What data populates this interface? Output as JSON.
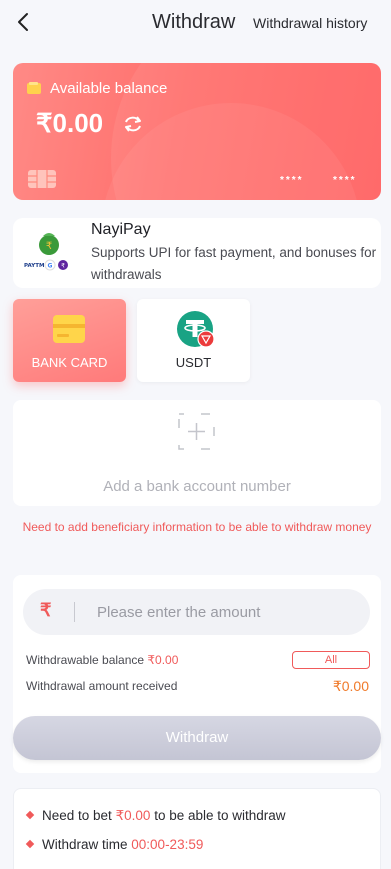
{
  "header": {
    "title": "Withdraw",
    "history_label": "Withdrawal history"
  },
  "balance_card": {
    "label": "Available balance",
    "amount": "₹0.00",
    "mask1": "****",
    "mask2": "****"
  },
  "nayipay": {
    "title": "NayiPay",
    "description": "Supports UPI for fast payment, and bonuses for withdrawals",
    "logo_text": "PAYTM"
  },
  "methods": [
    {
      "label": "BANK CARD",
      "icon": "bank-card-icon",
      "selected": true
    },
    {
      "label": "USDT",
      "icon": "tether-icon",
      "selected": false
    }
  ],
  "add_bank": {
    "label": "Add a bank account number"
  },
  "warning": "Need to add beneficiary information to be able to withdraw money",
  "amount_panel": {
    "currency_symbol": "₹",
    "placeholder": "Please enter the amount",
    "withdrawable_label": "Withdrawable balance ",
    "withdrawable_value": "₹0.00",
    "all_label": "All",
    "received_label": "Withdrawal amount received",
    "received_value": "₹0.00",
    "withdraw_label": "Withdraw"
  },
  "rules": {
    "r1_pre": "Need to bet ",
    "r1_value": "₹0.00",
    "r1_post": " to be able to withdraw",
    "r2_pre": "Withdraw time ",
    "r2_value": "00:00-23:59"
  },
  "colors": {
    "accent": "#f05a5a",
    "card_gradient_start": "#ff8a86",
    "card_gradient_end": "#ff5f5f",
    "amount_orange": "#f07a2a"
  }
}
